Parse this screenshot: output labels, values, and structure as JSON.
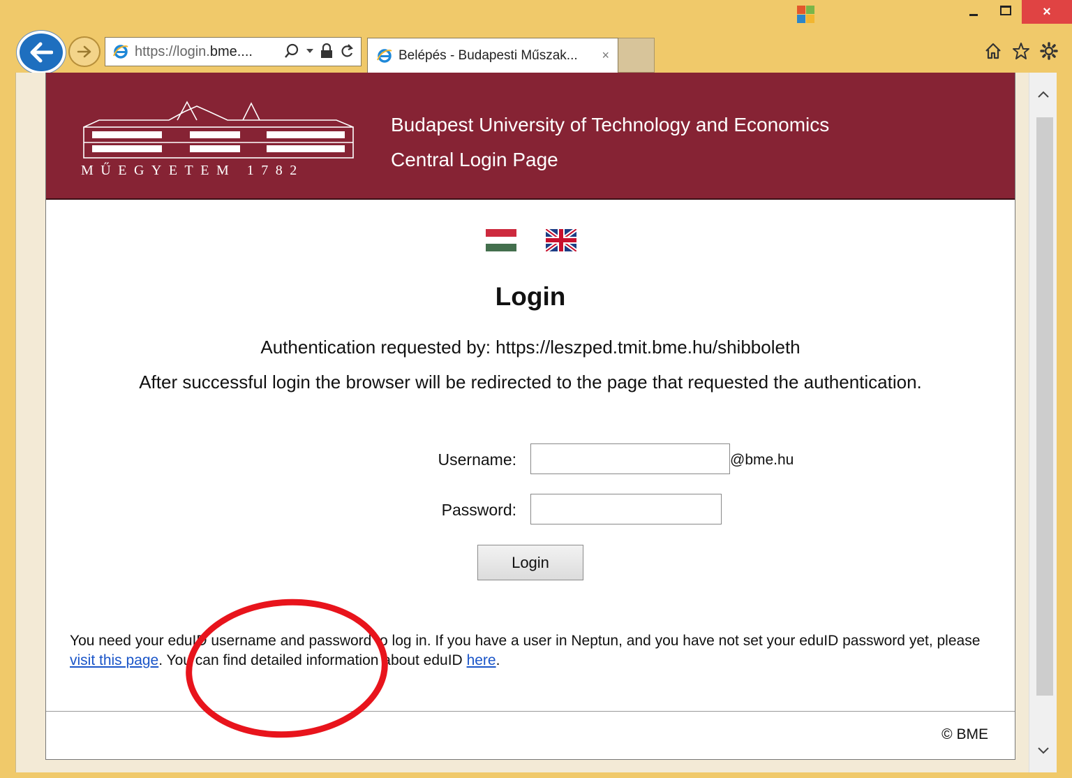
{
  "browser": {
    "address_url_main": "https://login.",
    "address_url_host": "bme",
    "address_url_rest": "....",
    "tab_title": "Belépés - Budapesti Műszak...",
    "tab_close": "×",
    "window_close": "×"
  },
  "header": {
    "logo_text": "MŰEGYETEM 1782",
    "title_line1": "Budapest University of Technology and Economics",
    "title_line2": "Central Login Page"
  },
  "main": {
    "heading": "Login",
    "requested_by": "Authentication requested by: https://leszped.tmit.bme.hu/shibboleth",
    "redirect_note": "After successful login the browser will be redirected to the page that requested the authentication.",
    "username_label": "Username:",
    "username_value": "",
    "username_suffix": "@bme.hu",
    "password_label": "Password:",
    "password_value": "",
    "login_button": "Login",
    "info_part1": "You need your eduID username and password to log in. If you have a user in Neptun, and you have not set your eduID password yet, please ",
    "info_link1": "visit this page",
    "info_part2": ". You can find detailed information about eduID ",
    "info_link2": "here",
    "info_part3": "."
  },
  "footer": {
    "copyright": "© BME"
  },
  "colors": {
    "chrome": "#f0c96a",
    "header_bg": "#862334",
    "link": "#1a55c8",
    "annotation": "#e8141c"
  },
  "icons": [
    "back-arrow-icon",
    "forward-arrow-icon",
    "ie-logo-icon",
    "search-icon",
    "lock-icon",
    "refresh-icon",
    "home-icon",
    "star-icon",
    "gear-icon",
    "hungarian-flag-icon",
    "uk-flag-icon"
  ]
}
